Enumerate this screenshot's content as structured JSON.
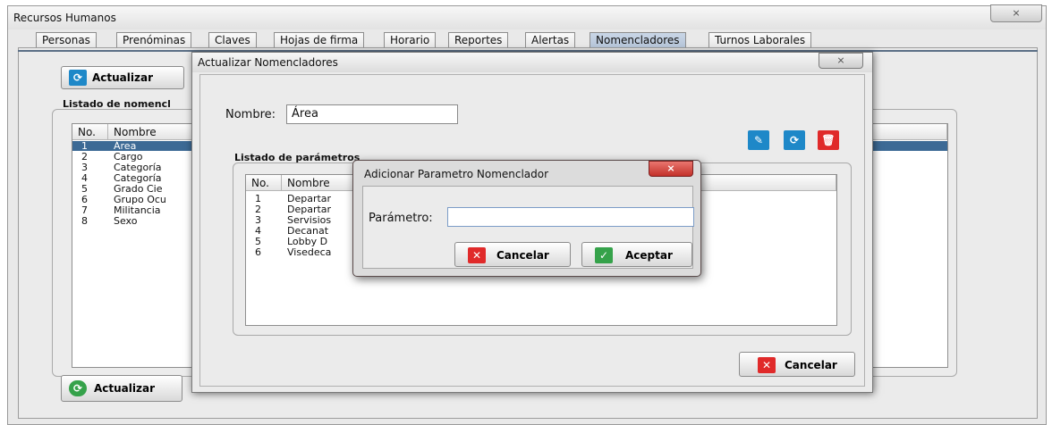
{
  "main_window": {
    "title": "Recursos Humanos",
    "close": "⨯"
  },
  "tabs": [
    {
      "label": "Personas"
    },
    {
      "label": "Prenóminas"
    },
    {
      "label": "Claves"
    },
    {
      "label": "Hojas de firma"
    },
    {
      "label": "Horario"
    },
    {
      "label": "Reportes"
    },
    {
      "label": "Alertas"
    },
    {
      "label": "Nomencladores"
    },
    {
      "label": "Turnos Laborales"
    }
  ],
  "selected_tab": "Nomencladores",
  "main": {
    "top_button": "Actualizar",
    "list_title": "Listado de nomencl",
    "bottom_button": "Actualizar",
    "table": {
      "headers": [
        "No.",
        "Nombre"
      ],
      "rows": [
        [
          "1",
          "Área"
        ],
        [
          "2",
          "Cargo"
        ],
        [
          "3",
          "Categoría"
        ],
        [
          "4",
          "Categoría"
        ],
        [
          "5",
          "Grado Cie"
        ],
        [
          "6",
          "Grupo Ocu"
        ],
        [
          "7",
          "Militancia"
        ],
        [
          "8",
          "Sexo"
        ]
      ],
      "selected_row": "1"
    }
  },
  "dialog_update": {
    "title": "Actualizar Nomencladores",
    "close": "⨯",
    "name_label": "Nombre:",
    "name_value": "Área",
    "params_title": "Listado de parámetros",
    "params_table": {
      "headers": [
        "No.",
        "Nombre"
      ],
      "rows": [
        [
          "1",
          "Departar"
        ],
        [
          "2",
          "Departar"
        ],
        [
          "3",
          "Servisios"
        ],
        [
          "4",
          "Decanat"
        ],
        [
          "5",
          "Lobby D"
        ],
        [
          "6",
          "Visedeca"
        ]
      ]
    },
    "cancel_button": "Cancelar",
    "icons": [
      "pin-icon",
      "refresh-icon",
      "trash-icon"
    ]
  },
  "dialog_add": {
    "title": "Adicionar Parametro Nomenclador",
    "close": "⨯",
    "param_label": "Parámetro:",
    "param_value": "",
    "cancel_button": "Cancelar",
    "accept_button": "Aceptar"
  },
  "colors": {
    "selection": "#3d6a95",
    "refresh_blue": "#1e88c8",
    "danger_red": "#e02a2a",
    "accept_green": "#35a24a"
  }
}
